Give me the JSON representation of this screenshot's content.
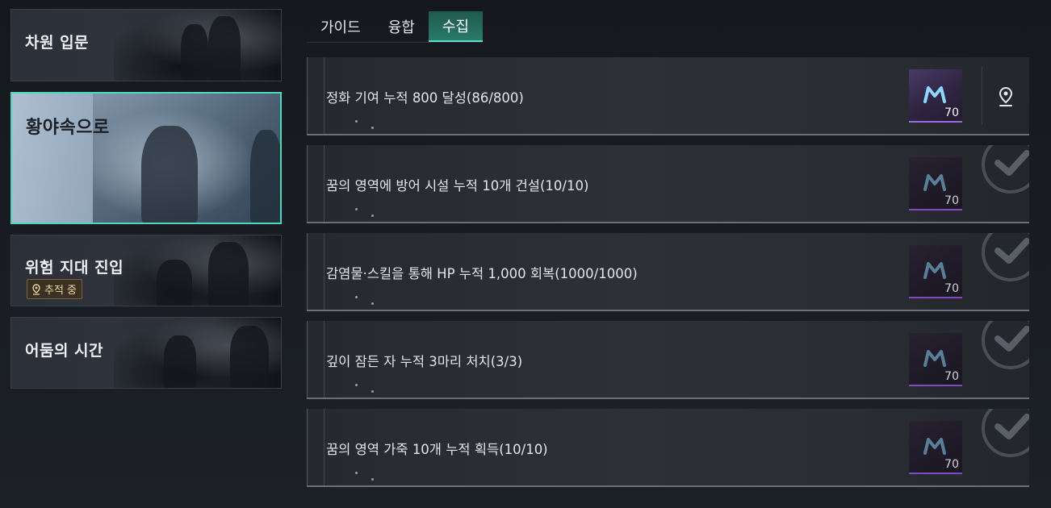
{
  "chapters": [
    {
      "title": "차원 입문",
      "selected": false
    },
    {
      "title": "황야속으로",
      "selected": true
    },
    {
      "title": "위험 지대 진입",
      "selected": false,
      "badge": "추적 중"
    },
    {
      "title": "어둠의 시간",
      "selected": false
    }
  ],
  "tabs": [
    {
      "label": "가이드",
      "active": false
    },
    {
      "label": "융합",
      "active": false
    },
    {
      "label": "수집",
      "active": true
    }
  ],
  "quests": [
    {
      "text": "정화 기여 누적 800 달성(86/800)",
      "reward_qty": "70",
      "completed": false
    },
    {
      "text": "꿈의 영역에 방어 시설 누적 10개 건설(10/10)",
      "reward_qty": "70",
      "completed": true
    },
    {
      "text": "감염물·스킬을 통해 HP 누적 1,000 회복(1000/1000)",
      "reward_qty": "70",
      "completed": true
    },
    {
      "text": "깊이 잠든 자 누적 3마리 처치(3/3)",
      "reward_qty": "70",
      "completed": true
    },
    {
      "text": "꿈의 영역 가죽 10개 누적 획득(10/10)",
      "reward_qty": "70",
      "completed": true
    }
  ],
  "colors": {
    "accent": "#57e0c7",
    "reward_border": "#7e4cc0",
    "tracking_text": "#f0d9a6"
  },
  "icons": {
    "reward": "crystal-currency-icon",
    "locate": "map-pin-icon",
    "done": "checkmark-icon",
    "tracking": "map-pin-icon"
  }
}
